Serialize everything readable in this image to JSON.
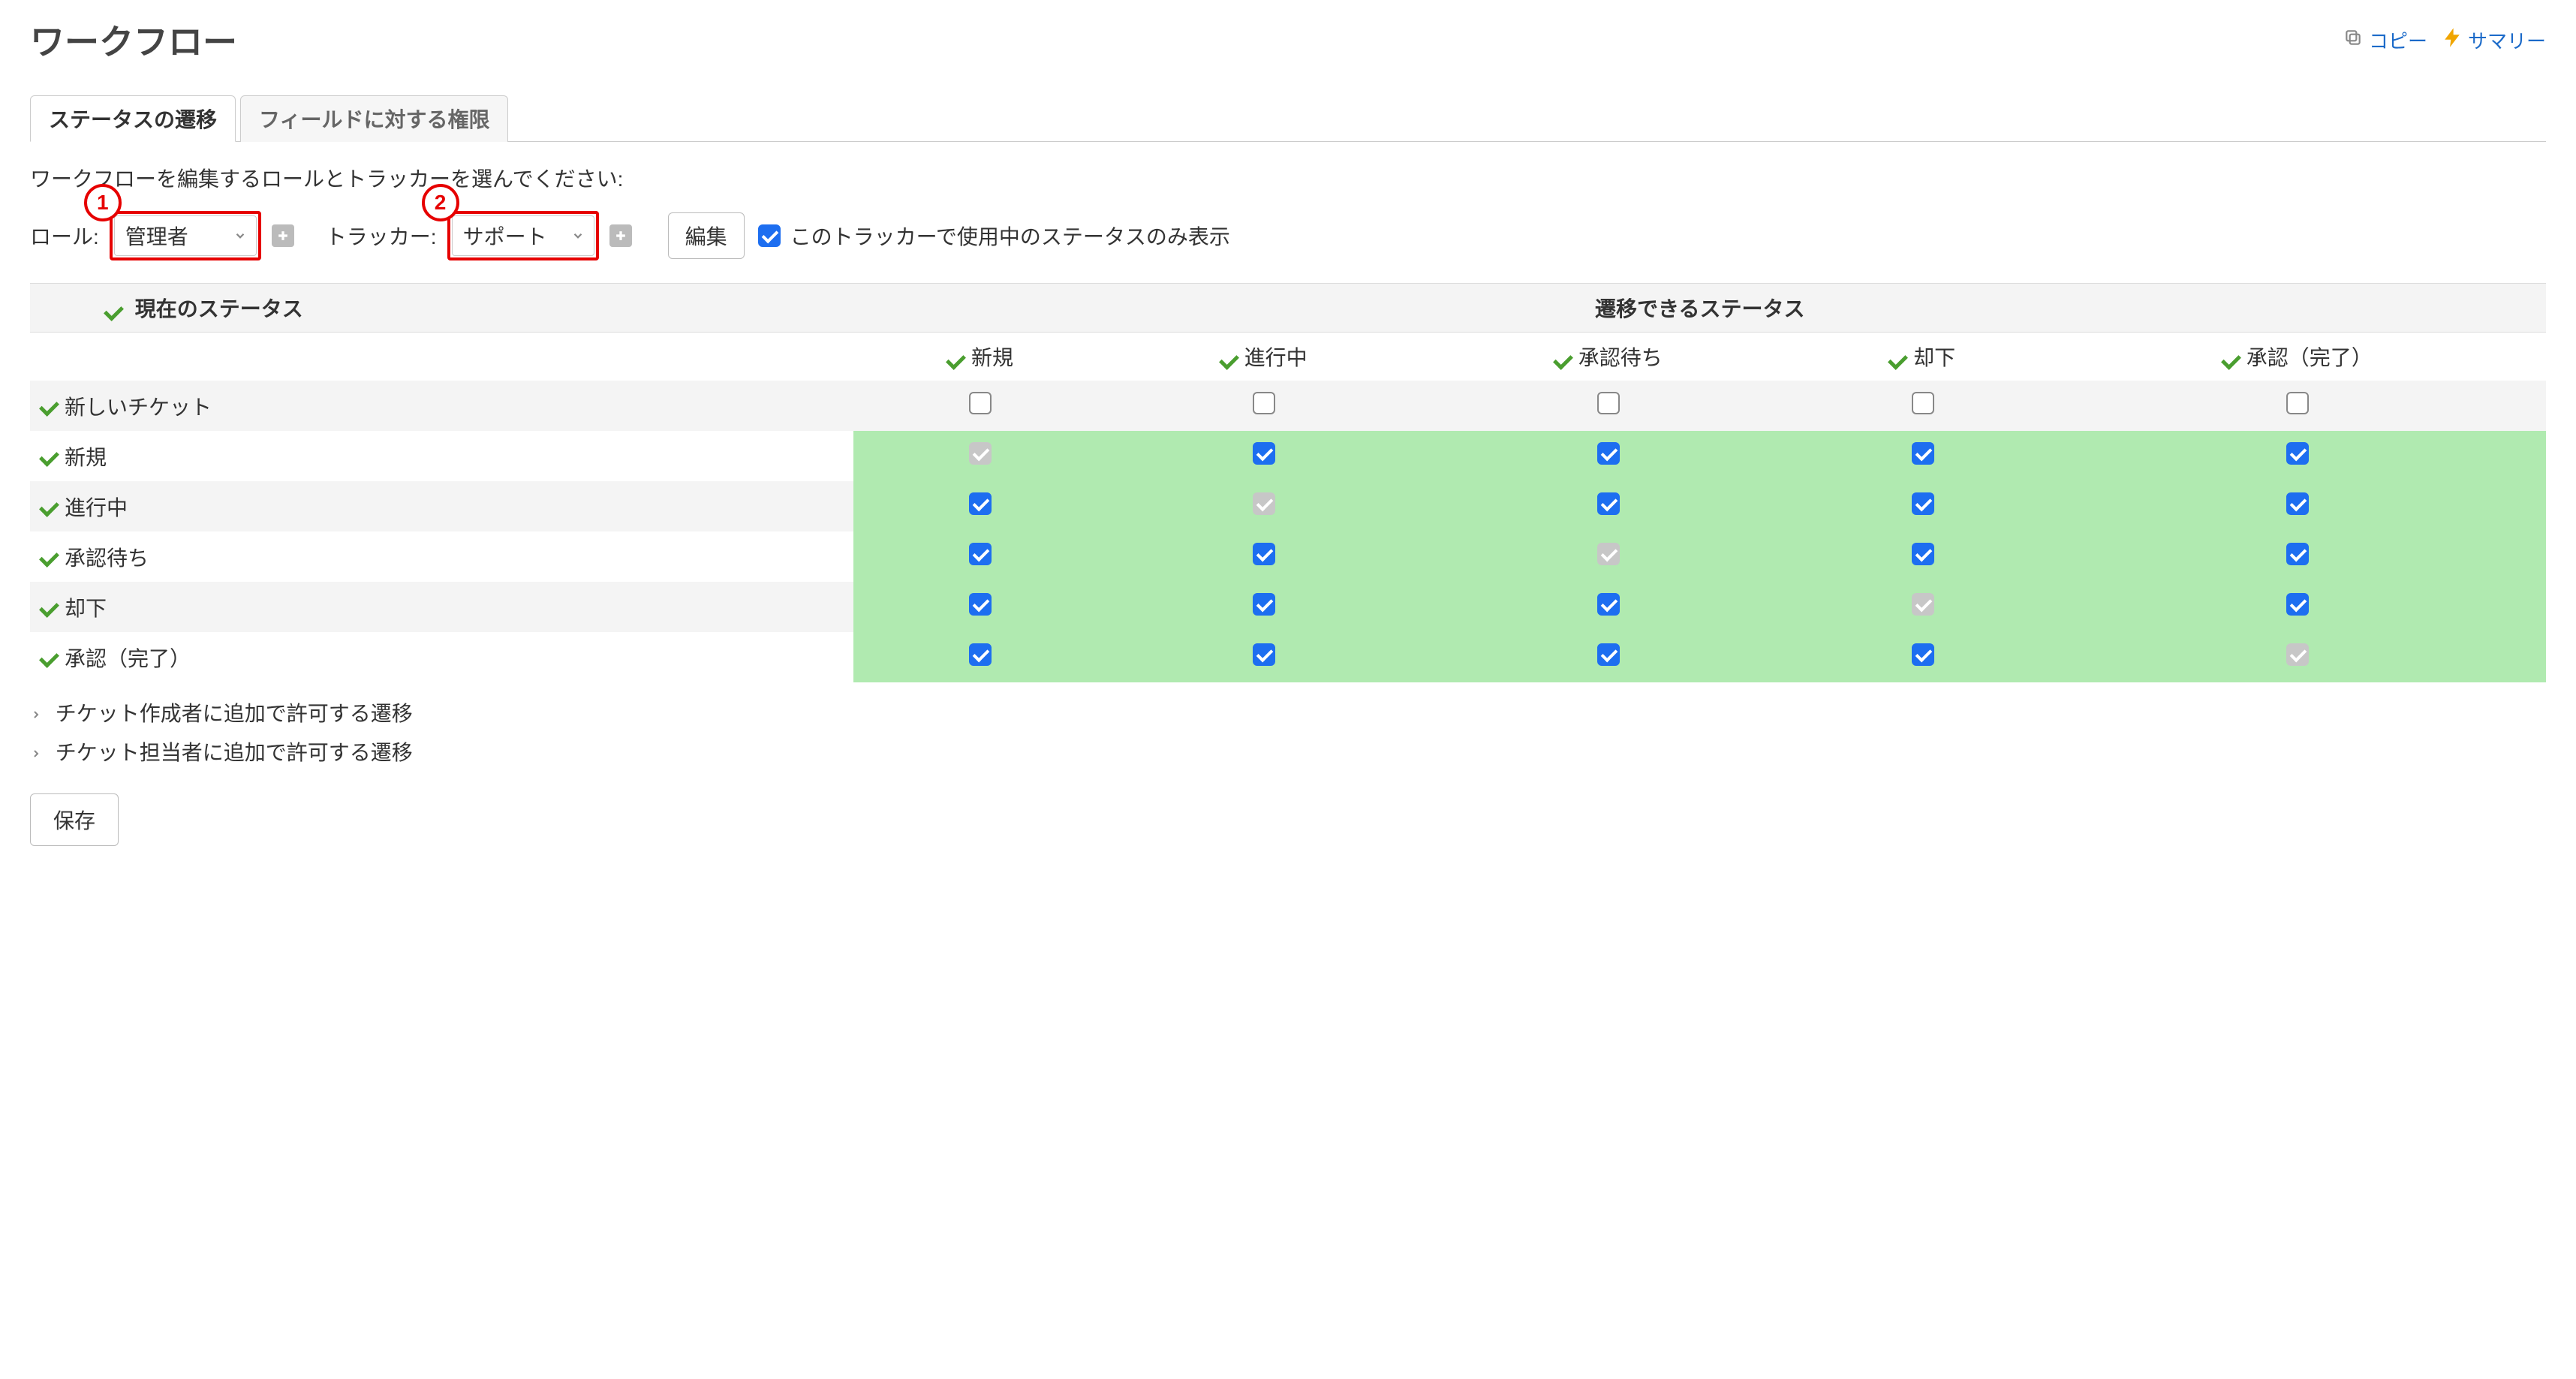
{
  "header": {
    "title": "ワークフロー",
    "links": {
      "copy": "コピー",
      "summary": "サマリー"
    }
  },
  "tabs": {
    "transitions": "ステータスの遷移",
    "field_perms": "フィールドに対する権限"
  },
  "instruction": "ワークフローを編集するロールとトラッカーを選んでください:",
  "filters": {
    "role_label": "ロール:",
    "role_value": "管理者",
    "tracker_label": "トラッカー:",
    "tracker_value": "サポート",
    "edit_button": "編集",
    "used_only_label": "このトラッカーで使用中のステータスのみ表示",
    "used_only_checked": true,
    "annot1": "1",
    "annot2": "2"
  },
  "table": {
    "current_status_header": "現在のステータス",
    "allowed_status_header": "遷移できるステータス",
    "columns": [
      "新規",
      "進行中",
      "承認待ち",
      "却下",
      "承認（完了）"
    ],
    "rows": [
      {
        "label": "新しいチケット",
        "cells": [
          {
            "state": "unchecked"
          },
          {
            "state": "unchecked"
          },
          {
            "state": "unchecked"
          },
          {
            "state": "unchecked"
          },
          {
            "state": "unchecked"
          }
        ],
        "green": false
      },
      {
        "label": "新規",
        "cells": [
          {
            "state": "disabled"
          },
          {
            "state": "checked"
          },
          {
            "state": "checked"
          },
          {
            "state": "checked"
          },
          {
            "state": "checked"
          }
        ],
        "green": true
      },
      {
        "label": "進行中",
        "cells": [
          {
            "state": "checked"
          },
          {
            "state": "disabled"
          },
          {
            "state": "checked"
          },
          {
            "state": "checked"
          },
          {
            "state": "checked"
          }
        ],
        "green": true
      },
      {
        "label": "承認待ち",
        "cells": [
          {
            "state": "checked"
          },
          {
            "state": "checked"
          },
          {
            "state": "disabled"
          },
          {
            "state": "checked"
          },
          {
            "state": "checked"
          }
        ],
        "green": true
      },
      {
        "label": "却下",
        "cells": [
          {
            "state": "checked"
          },
          {
            "state": "checked"
          },
          {
            "state": "checked"
          },
          {
            "state": "disabled"
          },
          {
            "state": "checked"
          }
        ],
        "green": true
      },
      {
        "label": "承認（完了）",
        "cells": [
          {
            "state": "checked"
          },
          {
            "state": "checked"
          },
          {
            "state": "checked"
          },
          {
            "state": "checked"
          },
          {
            "state": "disabled"
          }
        ],
        "green": true
      }
    ]
  },
  "expanders": {
    "creator": "チケット作成者に追加で許可する遷移",
    "assignee": "チケット担当者に追加で許可する遷移"
  },
  "save_button": "保存"
}
